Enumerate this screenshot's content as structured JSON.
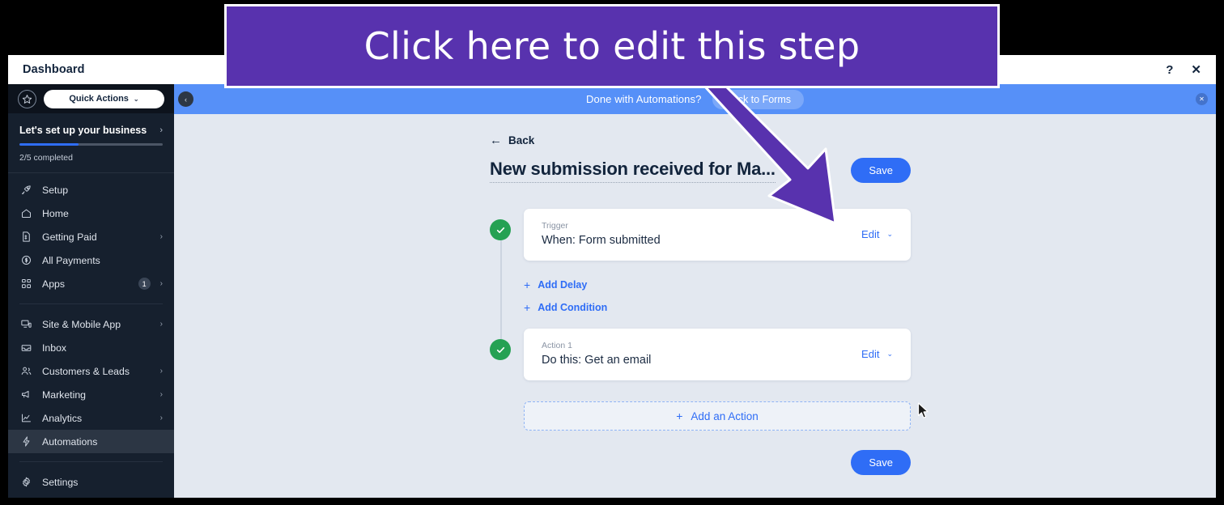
{
  "window": {
    "header_title": "Dashboard",
    "help_icon": "?",
    "close_icon": "✕"
  },
  "sidebar": {
    "star_icon": "star-outline-icon",
    "quick_actions_label": "Quick Actions",
    "quick_actions_chevron": "⌄",
    "setup": {
      "title": "Let's set up your business",
      "chevron": "›",
      "progress_text": "2/5 completed",
      "progress_percent": 41
    },
    "groups": [
      {
        "items": [
          {
            "label": "Setup",
            "icon": "rocket-icon",
            "chevron": "",
            "badge": ""
          },
          {
            "label": "Home",
            "icon": "home-icon",
            "chevron": "",
            "badge": ""
          },
          {
            "label": "Getting Paid",
            "icon": "invoice-icon",
            "chevron": "›",
            "badge": ""
          },
          {
            "label": "All Payments",
            "icon": "dollar-circle-icon",
            "chevron": "",
            "badge": ""
          },
          {
            "label": "Apps",
            "icon": "apps-grid-icon",
            "chevron": "›",
            "badge": "1"
          }
        ]
      },
      {
        "items": [
          {
            "label": "Site & Mobile App",
            "icon": "monitor-mobile-icon",
            "chevron": "›",
            "badge": ""
          },
          {
            "label": "Inbox",
            "icon": "inbox-icon",
            "chevron": "",
            "badge": ""
          },
          {
            "label": "Customers & Leads",
            "icon": "people-icon",
            "chevron": "›",
            "badge": ""
          },
          {
            "label": "Marketing",
            "icon": "megaphone-icon",
            "chevron": "›",
            "badge": ""
          },
          {
            "label": "Analytics",
            "icon": "chart-line-icon",
            "chevron": "›",
            "badge": ""
          },
          {
            "label": "Automations",
            "icon": "lightning-icon",
            "chevron": "",
            "badge": "",
            "active": true
          }
        ]
      },
      {
        "items": [
          {
            "label": "Settings",
            "icon": "gear-icon",
            "chevron": "",
            "badge": ""
          }
        ]
      }
    ]
  },
  "blue_bar": {
    "collapse_icon": "‹",
    "message": "Done with Automations?",
    "back_to_forms_label": "Back to Forms",
    "close_icon": "✕"
  },
  "builder": {
    "back_label": "Back",
    "back_arrow": "←",
    "flow_title": "New submission received for Ma...",
    "save_label": "Save",
    "steps": [
      {
        "kicker": "Trigger",
        "title": "When: Form submitted",
        "edit_label": "Edit",
        "edit_chevron": "⌄",
        "status_icon": "check-icon"
      },
      {
        "kicker": "Action 1",
        "title": "Do this: Get an email",
        "edit_label": "Edit",
        "edit_chevron": "⌄",
        "status_icon": "check-icon"
      }
    ],
    "mid_links": [
      {
        "label": "Add Delay",
        "icon": "plus-icon"
      },
      {
        "label": "Add Condition",
        "icon": "plus-icon"
      }
    ],
    "add_action_label": "Add an Action",
    "add_action_icon": "plus-icon",
    "bottom_save_label": "Save"
  },
  "annotation": {
    "banner_text": "Click here to edit this step",
    "arrow_icon": "down-right-arrow-icon"
  },
  "colors": {
    "annotation_purple": "#5832ae",
    "blue_bar": "#5690f8",
    "accent_blue": "#2f6df6",
    "success_green": "#25a153",
    "canvas_bg": "#e3e8f0",
    "sidebar_bg": "#16202e"
  }
}
